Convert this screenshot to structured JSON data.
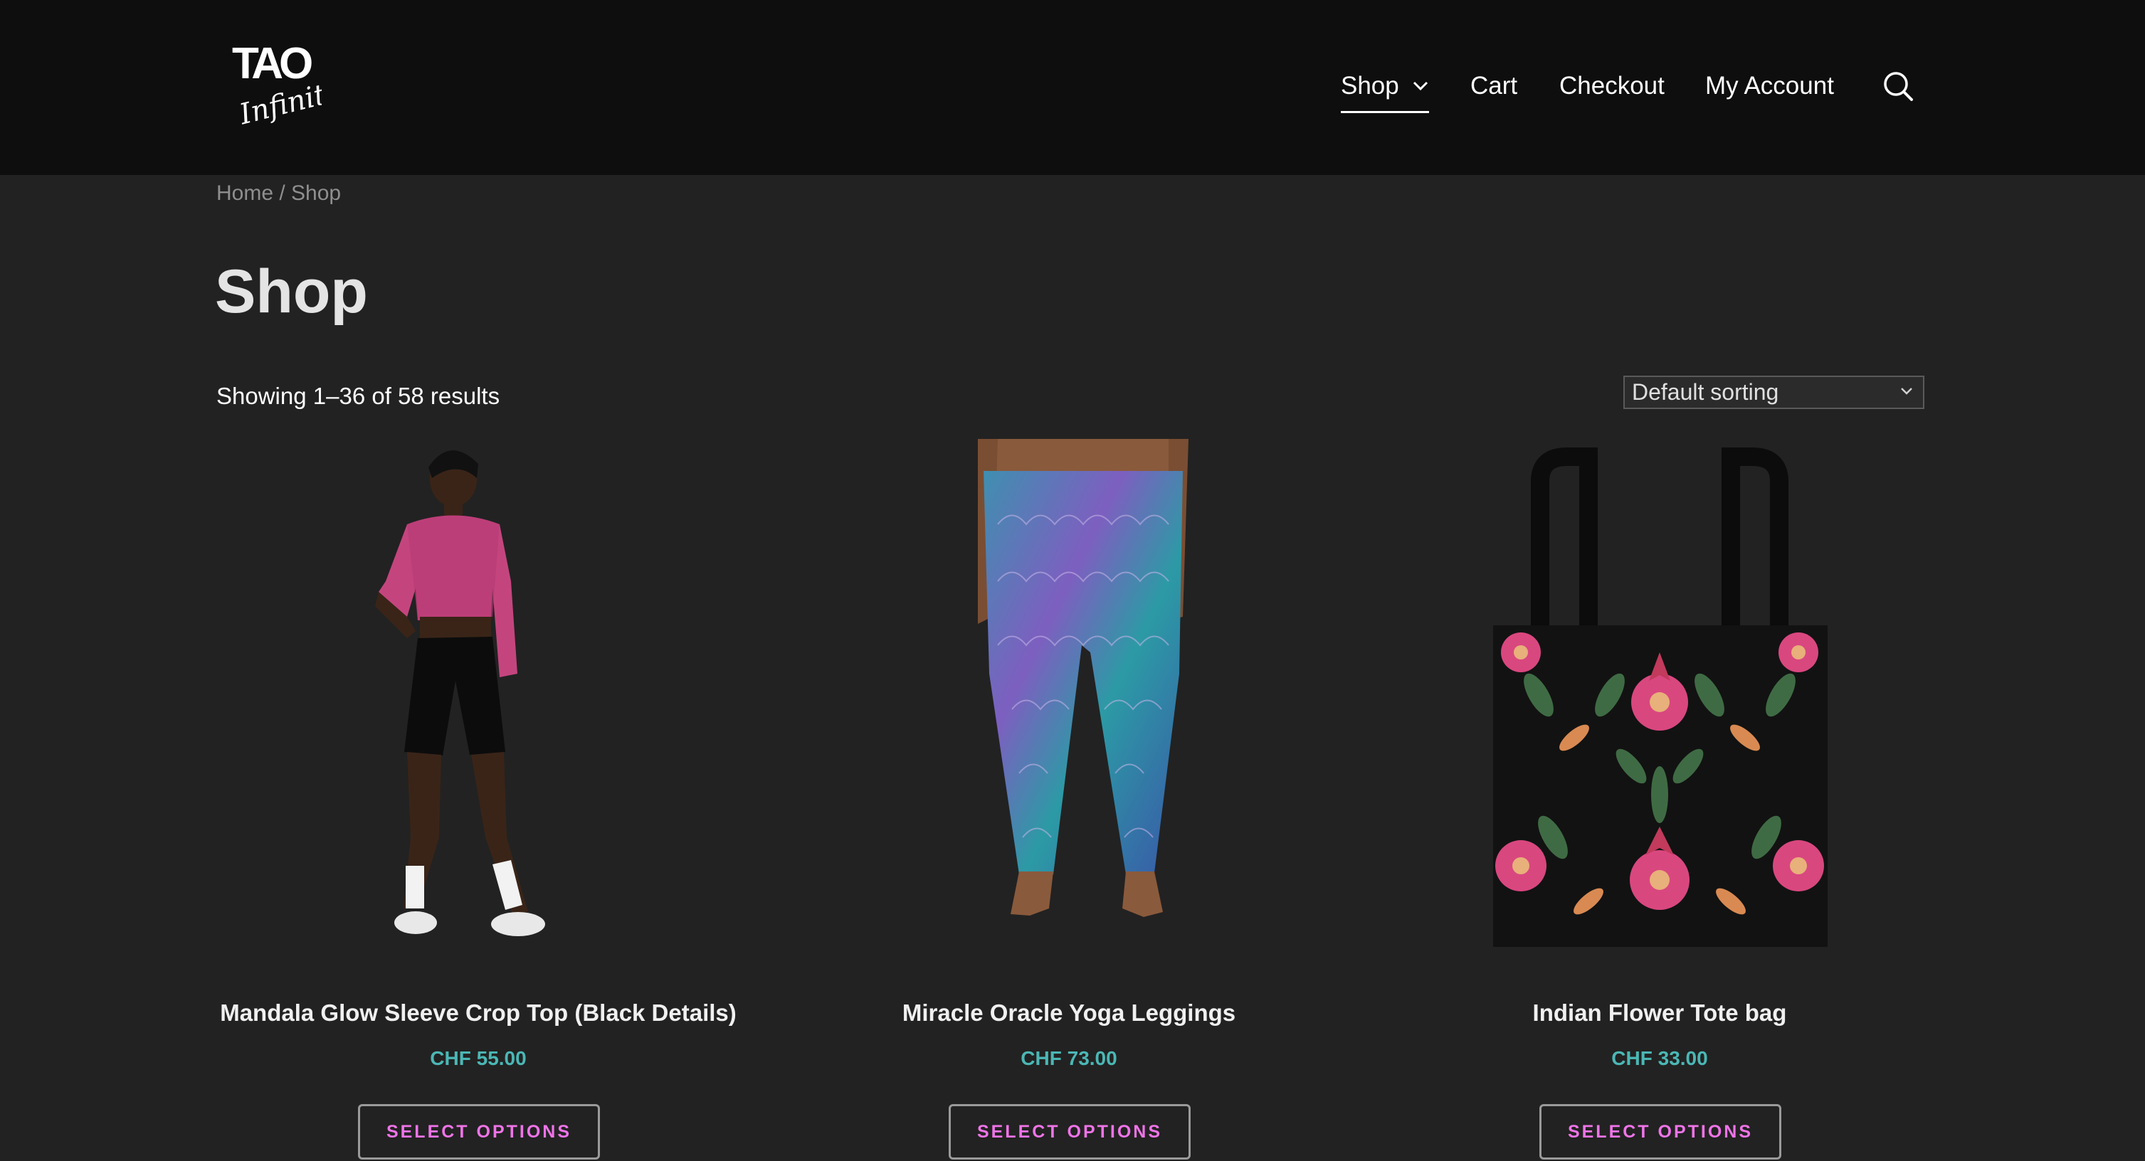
{
  "brand": {
    "logo_line1": "TAO",
    "logo_line2": "Infinity"
  },
  "nav": {
    "items": [
      {
        "label": "Shop",
        "active": true,
        "has_dropdown": true
      },
      {
        "label": "Cart"
      },
      {
        "label": "Checkout"
      },
      {
        "label": "My Account"
      }
    ],
    "search_icon": "search-icon"
  },
  "breadcrumb": "Home / Shop",
  "page": {
    "title": "Shop",
    "result_count": "Showing 1–36 of 58 results"
  },
  "sorting": {
    "selected": "Default sorting"
  },
  "colors": {
    "page_bg": "#222222",
    "header_bg": "#0e0e0e",
    "price": "#4bb7b5",
    "button_text": "#ef74e8"
  },
  "products": [
    {
      "title": "Mandala Glow Sleeve Crop Top (Black Details)",
      "price": "CHF 55.00",
      "button": "SELECT OPTIONS"
    },
    {
      "title": "Miracle Oracle Yoga Leggings",
      "price": "CHF 73.00",
      "button": "SELECT OPTIONS"
    },
    {
      "title": "Indian Flower Tote bag",
      "price": "CHF 33.00",
      "button": "SELECT OPTIONS"
    }
  ]
}
